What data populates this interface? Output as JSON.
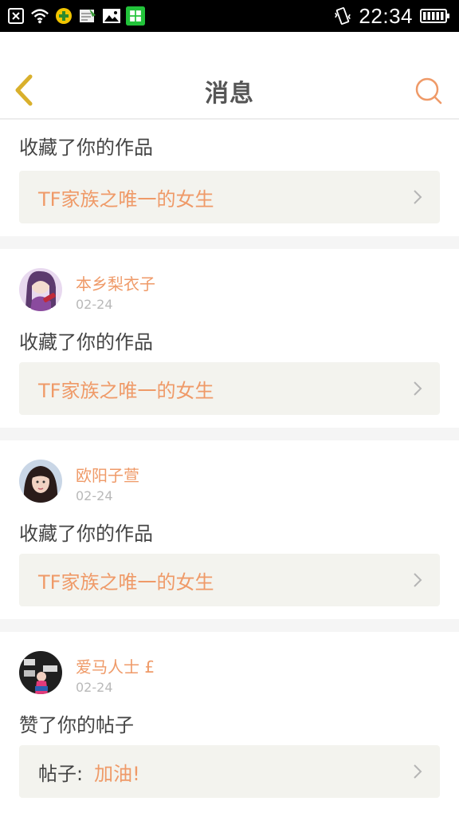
{
  "status_bar": {
    "time": "22:34",
    "left_icons": [
      "close-box-icon",
      "wifi-icon",
      "plus-badge-icon",
      "note-icon",
      "image-icon",
      "grid-app-icon"
    ],
    "right_icons": [
      "vibrate-icon",
      "battery-icon"
    ]
  },
  "header": {
    "title": "消息",
    "back_icon": "chevron-left-icon",
    "search_icon": "search-icon"
  },
  "colors": {
    "accent": "#ef9a68",
    "back_arrow": "#d9b02c",
    "card_bg": "#f3f3ee",
    "separator": "#f5f5f5"
  },
  "messages": [
    {
      "action": "收藏了你的作品",
      "card_title": "TF家族之唯一的女生"
    },
    {
      "username": "本乡梨衣子",
      "date": "02-24",
      "action": "收藏了你的作品",
      "card_title": "TF家族之唯一的女生"
    },
    {
      "username": "欧阳子萱",
      "date": "02-24",
      "action": "收藏了你的作品",
      "card_title": "TF家族之唯一的女生"
    },
    {
      "username": "爱马人士 £",
      "date": "02-24",
      "action": "赞了你的帖子",
      "card_prefix": "帖子:",
      "card_title": "加油!"
    }
  ]
}
